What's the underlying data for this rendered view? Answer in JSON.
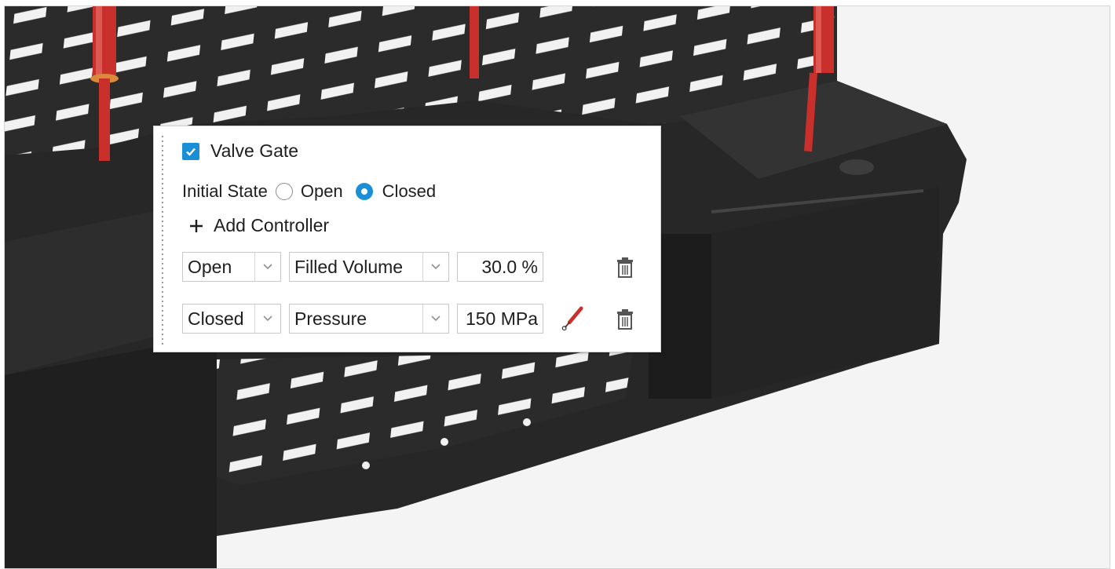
{
  "valve_gate": {
    "enabled": true,
    "label": "Valve Gate",
    "initial_state_label": "Initial State",
    "options": [
      "Open",
      "Closed"
    ],
    "selected": "Closed"
  },
  "add_controller_label": "Add Controller",
  "controllers": [
    {
      "state": "Open",
      "criterion": "Filled Volume",
      "value": "30.0 %",
      "has_probe": false
    },
    {
      "state": "Closed",
      "criterion": "Pressure",
      "value": "150 MPa",
      "has_probe": true
    }
  ],
  "icons": {
    "checkbox": "check-icon",
    "add": "plus-icon",
    "dropdown": "chevron-down-icon",
    "delete": "trash-icon",
    "probe": "probe-icon"
  },
  "colors": {
    "accent": "#1b8fd6",
    "part": "#2b2b2b",
    "gate_pin": "#c9302c",
    "background": "#f4f4f4"
  }
}
